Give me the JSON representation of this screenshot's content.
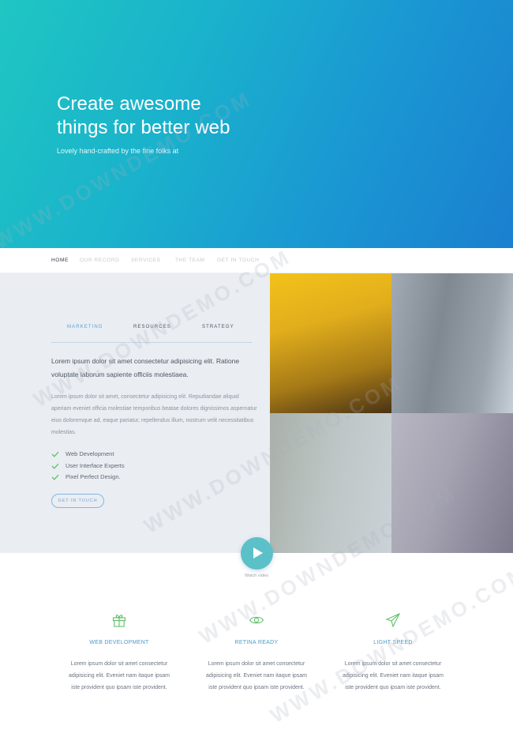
{
  "hero": {
    "title_line1": "Create awesome",
    "title_line2": "things for better web",
    "subtitle": "Lovely hand-crafted by the fine folks at"
  },
  "nav": {
    "items": [
      "HOME",
      "OUR RECORD",
      "SERVICES",
      "THE TEAM",
      "GET IN TOUCH"
    ],
    "active": "HOME"
  },
  "feature": {
    "tabs": [
      "MARKETING",
      "RESOURCES",
      "STRATEGY"
    ],
    "active_tab": "MARKETING",
    "lead": "Lorem ipsum dolor sit amet consectetur adipisicing elit. Ratione voluptate laborum sapiente officiis molestiaea.",
    "body": "Lorem ipsum dolor sit amet, consectetur adipisicing elit. Repudiandae aliquid aperiam eveniet officia molestiae temporibus beatae dolores dignissimos aspernatur eius doloremque ad, eaque pariatur, repellendus illum, nostrum velit necessitatibus molestias.",
    "checklist": [
      "Web Development",
      "User Interface Experts",
      "Pixel Perfect Design."
    ],
    "cta_label": "GET IN TOUCH"
  },
  "video": {
    "label": "Watch video"
  },
  "services": [
    {
      "icon": "gift-icon",
      "title": "WEB DEVELOPMENT",
      "text": "Lorem ipsum dolor sit amet consectetur adipisicing elit. Eveniet nam itaque ipsam iste provident quo ipsam iste provident."
    },
    {
      "icon": "eye-icon",
      "title": "RETINA READY",
      "text": "Lorem ipsum dolor sit amet consectetur adipisicing elit. Eveniet nam itaque ipsam iste provident quo ipsam iste provident."
    },
    {
      "icon": "paper-plane-icon",
      "title": "LIGHT SPEED",
      "text": "Lorem ipsum dolor sit amet consectetur adipisicing elit. Eveniet nam itaque ipsam iste provident quo ipsam iste provident."
    }
  ],
  "watermark": "WWW.DOWNDEMO.COM",
  "colors": {
    "accent": "#4a9bc5",
    "check_green": "#5fbf6b",
    "play": "#5cc0c9",
    "hero_start": "#1fc6c2",
    "hero_end": "#1a7fd0"
  }
}
